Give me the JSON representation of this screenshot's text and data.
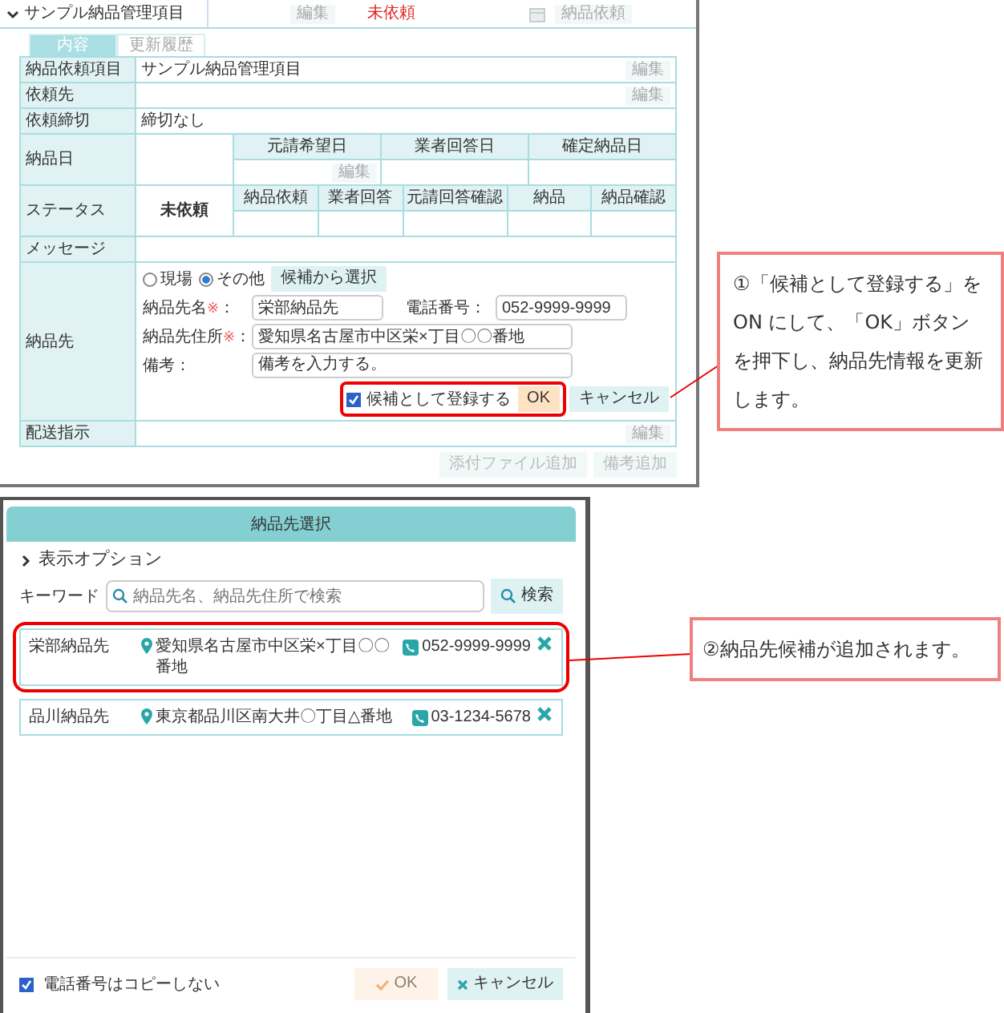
{
  "top_screen": {
    "header_row": {
      "title": "サンプル納品管理項目",
      "edit": "編集",
      "status": "未依頼",
      "request_button": "納品依頼"
    },
    "tabs": [
      {
        "label": "内容",
        "selected": true
      },
      {
        "label": "更新履歴",
        "selected": false
      }
    ],
    "item_row": {
      "label": "納品依頼項目",
      "value": "サンプル納品管理項目",
      "edit": "編集"
    },
    "client_row": {
      "label": "依頼先",
      "edit": "編集"
    },
    "deadline_row": {
      "label": "依頼締切",
      "value": "締切なし"
    },
    "date_row": {
      "label": "納品日",
      "columns": [
        "元請希望日",
        "業者回答日",
        "確定納品日"
      ],
      "edit": "編集"
    },
    "status_row": {
      "label": "ステータス",
      "value": "未依頼",
      "columns": [
        "納品依頼",
        "業者回答",
        "元請回答確認",
        "納品",
        "納品確認"
      ]
    },
    "message_row": {
      "label": "メッセージ"
    },
    "destination": {
      "label": "納品先",
      "radios": [
        {
          "label": "現場",
          "selected": false
        },
        {
          "label": "その他",
          "selected": true
        }
      ],
      "pick_button": "候補から選択",
      "fields": [
        {
          "label": "納品先名",
          "mark": "※",
          "suffix": "：",
          "value": "栄部納品先",
          "kind": "input"
        },
        {
          "label": "電話番号",
          "suffix": "：",
          "value": "052-9999-9999",
          "kind": "input"
        },
        {
          "label": "納品先住所",
          "mark": "※",
          "suffix": "：",
          "value": "愛知県名古屋市中区栄×丁目〇〇番地",
          "kind": "input"
        },
        {
          "label": "備考",
          "suffix": "：",
          "value": "備考を入力する。",
          "kind": "textarea"
        }
      ],
      "register": {
        "label": "候補として登録する",
        "checked": true
      },
      "ok": "OK",
      "cancel": "キャンセル"
    },
    "delivery_row": {
      "label": "配送指示",
      "edit": "編集"
    },
    "footer_buttons": [
      "添付ファイル追加",
      "備考追加"
    ]
  },
  "dialog": {
    "title": "納品先選択",
    "options": "表示オプション",
    "keyword_label": "キーワード",
    "search": {
      "placeholder": "納品先名、納品先住所で検索"
    },
    "search_button": "検索",
    "candidates": [
      {
        "name": "栄部納品先",
        "address": "愛知県名古屋市中区栄×丁目〇〇番地",
        "phone": "052-9999-9999",
        "highlighted": true
      },
      {
        "name": "品川納品先",
        "address": "東京都品川区南大井〇丁目△番地",
        "phone": "03-1234-5678",
        "highlighted": false
      }
    ],
    "no_copy": {
      "label": "電話番号はコピーしない",
      "checked": true
    },
    "ok": {
      "label": "OK",
      "disabled": true
    },
    "cancel": "キャンセル"
  },
  "callouts": [
    {
      "text": "①「候補として登録する」をON にして、「OK」ボタンを押下し、納品先情報を更新します。"
    },
    {
      "text": "②納品先候補が追加されます。"
    }
  ]
}
